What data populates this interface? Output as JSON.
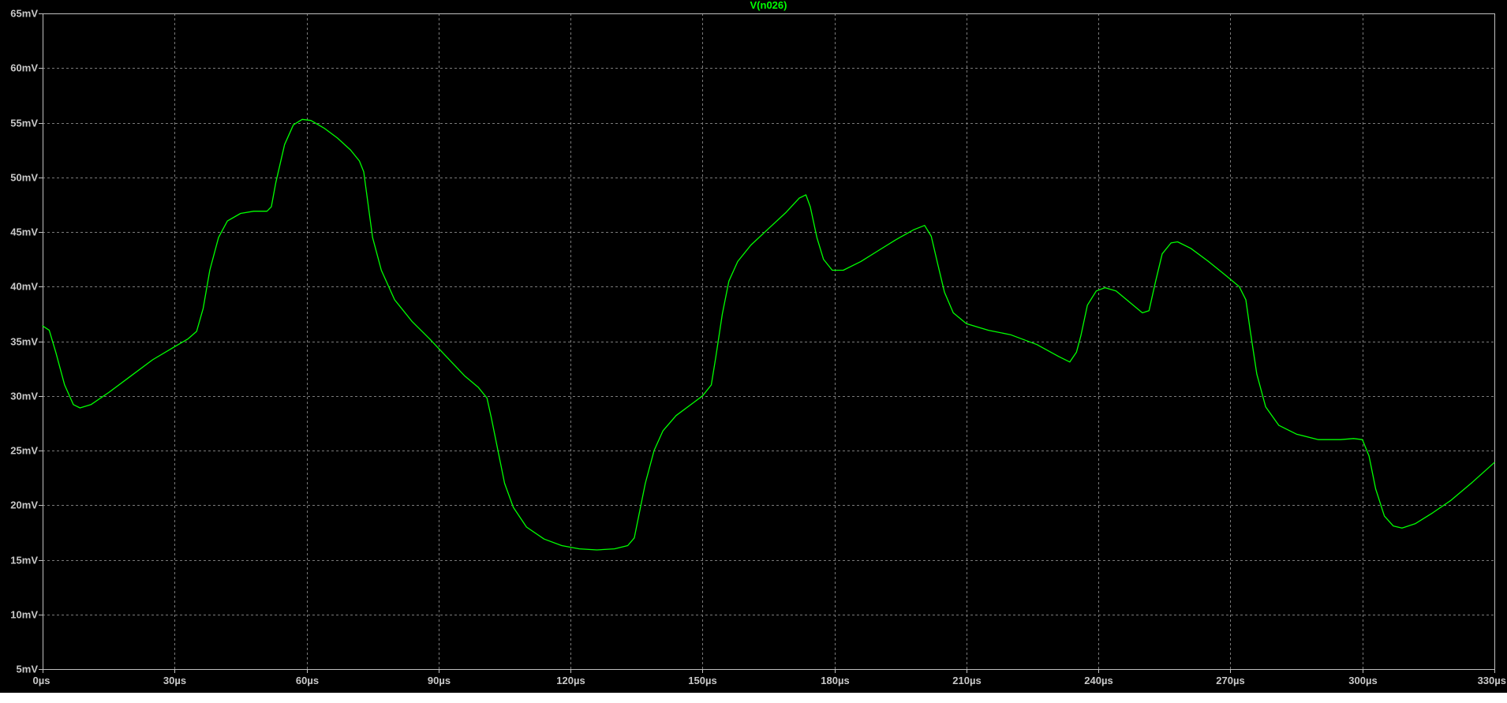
{
  "title": "V(n026)",
  "colors": {
    "background": "#000000",
    "frame": "#c0c0c0",
    "grid": "#7a7a7a",
    "trace": "#00ff00",
    "title": "#00ff00",
    "tick_label": "#c8c8c8",
    "page_bottom": "#ffffff"
  },
  "chart_data": {
    "type": "line",
    "title": "V(n026)",
    "xlabel": "",
    "ylabel": "",
    "x_unit": "µs",
    "y_unit": "mV",
    "xlim": [
      0,
      330
    ],
    "ylim": [
      5,
      65
    ],
    "grid": true,
    "grid_style": "dashed",
    "x_ticks": [
      0,
      30,
      60,
      90,
      120,
      150,
      180,
      210,
      240,
      270,
      300,
      330
    ],
    "x_tick_labels": [
      "0µs",
      "30µs",
      "60µs",
      "90µs",
      "120µs",
      "150µs",
      "180µs",
      "210µs",
      "240µs",
      "270µs",
      "300µs",
      "330µs"
    ],
    "y_ticks": [
      5,
      10,
      15,
      20,
      25,
      30,
      35,
      40,
      45,
      50,
      55,
      60,
      65
    ],
    "y_tick_labels": [
      "5mV",
      "10mV",
      "15mV",
      "20mV",
      "25mV",
      "30mV",
      "35mV",
      "40mV",
      "45mV",
      "50mV",
      "55mV",
      "60mV",
      "65mV"
    ],
    "series": [
      {
        "name": "V(n026)",
        "color": "#00ff00",
        "points": [
          [
            0,
            36.4
          ],
          [
            1.5,
            36.0
          ],
          [
            3,
            34.0
          ],
          [
            5,
            31.0
          ],
          [
            7,
            29.2
          ],
          [
            8.5,
            28.9
          ],
          [
            11,
            29.2
          ],
          [
            15,
            30.3
          ],
          [
            20,
            31.8
          ],
          [
            25,
            33.3
          ],
          [
            30,
            34.5
          ],
          [
            33,
            35.2
          ],
          [
            35,
            35.9
          ],
          [
            36.5,
            38.0
          ],
          [
            38,
            41.5
          ],
          [
            40,
            44.5
          ],
          [
            42,
            46.0
          ],
          [
            45,
            46.7
          ],
          [
            48,
            46.9
          ],
          [
            51,
            46.9
          ],
          [
            52,
            47.3
          ],
          [
            53,
            49.5
          ],
          [
            55,
            53.0
          ],
          [
            57,
            54.8
          ],
          [
            59,
            55.3
          ],
          [
            61,
            55.2
          ],
          [
            64,
            54.5
          ],
          [
            67,
            53.6
          ],
          [
            70,
            52.5
          ],
          [
            72,
            51.5
          ],
          [
            73,
            50.5
          ],
          [
            74,
            47.5
          ],
          [
            75,
            44.5
          ],
          [
            77,
            41.5
          ],
          [
            80,
            38.8
          ],
          [
            84,
            36.8
          ],
          [
            88,
            35.2
          ],
          [
            92,
            33.5
          ],
          [
            96,
            31.8
          ],
          [
            99,
            30.8
          ],
          [
            101,
            29.8
          ],
          [
            102,
            28.0
          ],
          [
            103.5,
            25.0
          ],
          [
            105,
            22.0
          ],
          [
            107,
            19.8
          ],
          [
            110,
            18.0
          ],
          [
            114,
            16.9
          ],
          [
            118,
            16.3
          ],
          [
            122,
            16.0
          ],
          [
            126,
            15.9
          ],
          [
            130,
            16.0
          ],
          [
            133,
            16.3
          ],
          [
            134.5,
            17.0
          ],
          [
            135.5,
            19.0
          ],
          [
            137,
            22.0
          ],
          [
            139,
            25.0
          ],
          [
            141,
            26.8
          ],
          [
            144,
            28.2
          ],
          [
            148,
            29.4
          ],
          [
            150,
            30.0
          ],
          [
            152,
            31.0
          ],
          [
            153,
            33.5
          ],
          [
            154.5,
            37.5
          ],
          [
            156,
            40.5
          ],
          [
            158,
            42.3
          ],
          [
            161,
            43.8
          ],
          [
            165,
            45.3
          ],
          [
            169,
            46.8
          ],
          [
            172,
            48.1
          ],
          [
            173.5,
            48.4
          ],
          [
            174.5,
            47.3
          ],
          [
            176,
            44.5
          ],
          [
            177.5,
            42.5
          ],
          [
            179.5,
            41.5
          ],
          [
            182,
            41.5
          ],
          [
            186,
            42.3
          ],
          [
            190,
            43.3
          ],
          [
            194,
            44.3
          ],
          [
            198,
            45.2
          ],
          [
            200.5,
            45.6
          ],
          [
            202,
            44.6
          ],
          [
            203.5,
            42.0
          ],
          [
            205,
            39.5
          ],
          [
            207,
            37.6
          ],
          [
            210,
            36.6
          ],
          [
            215,
            36.0
          ],
          [
            220,
            35.6
          ],
          [
            226,
            34.7
          ],
          [
            231,
            33.6
          ],
          [
            233.5,
            33.1
          ],
          [
            235,
            34.0
          ],
          [
            236,
            35.5
          ],
          [
            237.5,
            38.3
          ],
          [
            239.5,
            39.6
          ],
          [
            241.5,
            39.9
          ],
          [
            244,
            39.6
          ],
          [
            247,
            38.6
          ],
          [
            250,
            37.6
          ],
          [
            251.5,
            37.8
          ],
          [
            253,
            40.5
          ],
          [
            254.5,
            43.0
          ],
          [
            256.5,
            44.0
          ],
          [
            258,
            44.1
          ],
          [
            261,
            43.5
          ],
          [
            265,
            42.3
          ],
          [
            269,
            41.0
          ],
          [
            272,
            40.0
          ],
          [
            273.5,
            38.8
          ],
          [
            274.5,
            36.0
          ],
          [
            276,
            32.0
          ],
          [
            278,
            29.0
          ],
          [
            281,
            27.3
          ],
          [
            285,
            26.5
          ],
          [
            290,
            26.0
          ],
          [
            295,
            26.0
          ],
          [
            298,
            26.1
          ],
          [
            300,
            26.0
          ],
          [
            301.5,
            24.5
          ],
          [
            303,
            21.5
          ],
          [
            305,
            19.0
          ],
          [
            307,
            18.1
          ],
          [
            309,
            17.9
          ],
          [
            312,
            18.3
          ],
          [
            316,
            19.3
          ],
          [
            320,
            20.4
          ],
          [
            325,
            22.1
          ],
          [
            330,
            23.9
          ]
        ]
      }
    ]
  }
}
